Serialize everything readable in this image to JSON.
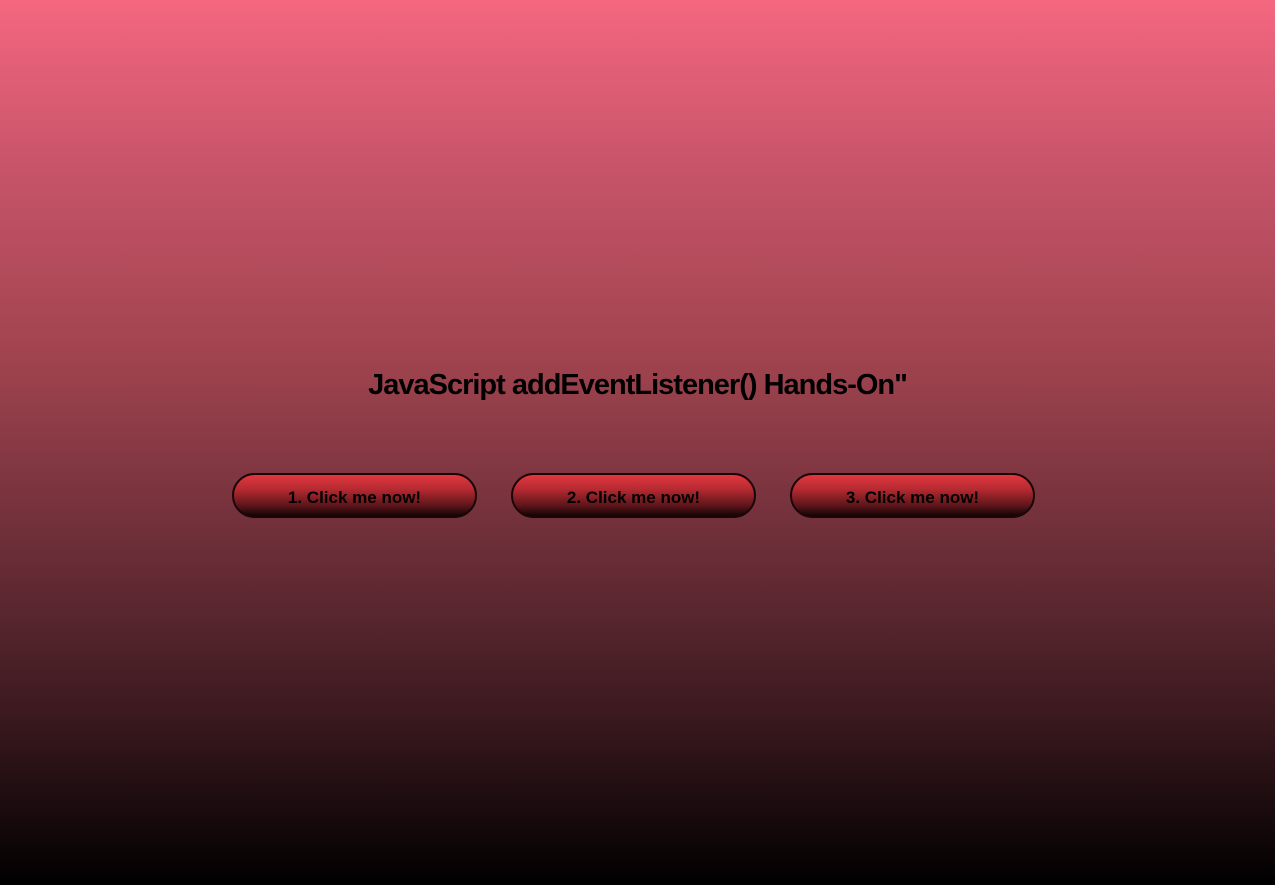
{
  "page": {
    "heading": "JavaScript addEventListener() Hands-On\""
  },
  "buttons": [
    {
      "label": "1. Click me now!"
    },
    {
      "label": "2. Click me now!"
    },
    {
      "label": "3. Click me now!"
    }
  ],
  "colors": {
    "background_top": "#f4677f",
    "background_bottom": "#000000",
    "button_top": "#e2373f",
    "button_bottom": "#120405",
    "text": "#000000"
  }
}
